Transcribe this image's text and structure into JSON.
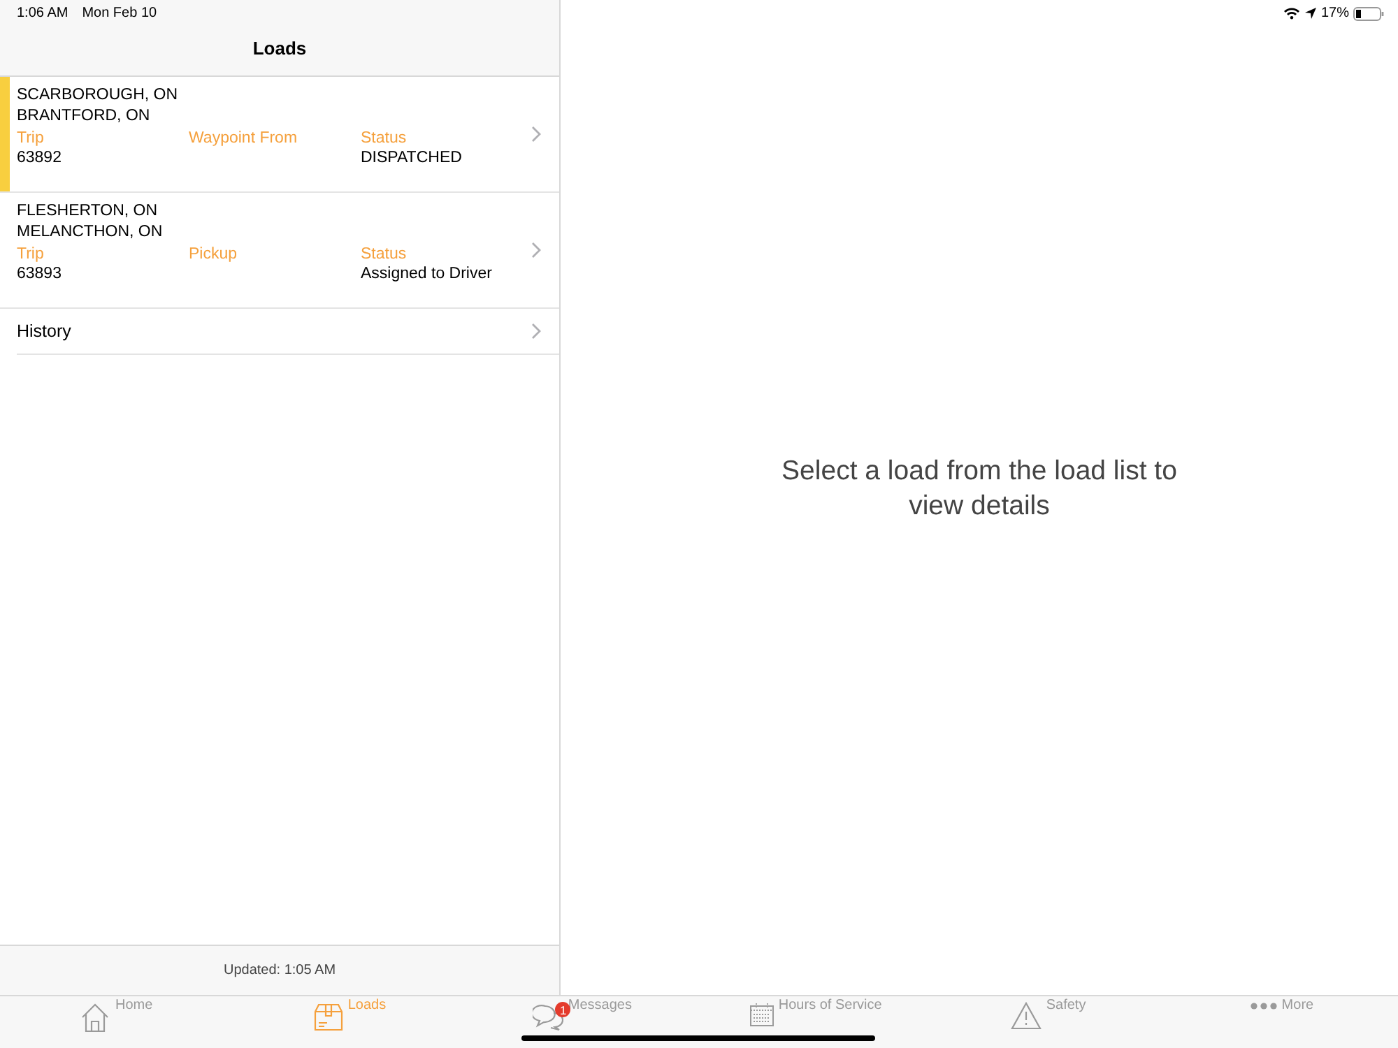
{
  "status_bar": {
    "time": "1:06 AM",
    "date": "Mon Feb 10",
    "battery": "17%"
  },
  "nav": {
    "title": "Loads"
  },
  "loads": [
    {
      "origin": "SCARBOROUGH, ON",
      "destination": "BRANTFORD, ON",
      "trip_label": "Trip",
      "trip": "63892",
      "stop_type": "Waypoint From",
      "status_label": "Status",
      "status": "DISPATCHED",
      "selected": true
    },
    {
      "origin": "FLESHERTON, ON",
      "destination": "MELANCTHON, ON",
      "trip_label": "Trip",
      "trip": "63893",
      "stop_type": "Pickup",
      "status_label": "Status",
      "status": "Assigned to Driver",
      "selected": false
    }
  ],
  "history": {
    "label": "History"
  },
  "footer": {
    "updated": "Updated: 1:05 AM"
  },
  "detail": {
    "message": "Select a load from the load list to view details"
  },
  "tabs": [
    {
      "kind": "home",
      "label": "Home",
      "selected": false
    },
    {
      "kind": "loads",
      "label": "Loads",
      "selected": true
    },
    {
      "kind": "messages",
      "label": "Messages",
      "selected": false,
      "badge": "1"
    },
    {
      "kind": "calendar",
      "label": "Hours of Service",
      "selected": false
    },
    {
      "kind": "safety",
      "label": "Safety",
      "selected": false
    },
    {
      "kind": "more",
      "label": "More",
      "selected": false
    }
  ]
}
